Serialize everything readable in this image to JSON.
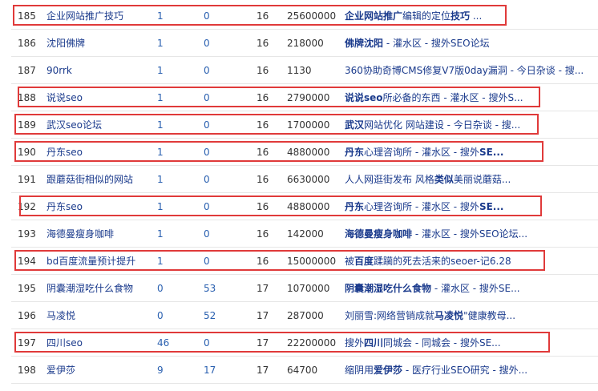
{
  "rows": [
    {
      "id": "185",
      "keyword": "企业网站推广技巧",
      "a": "1",
      "b": "0",
      "c": "16",
      "d": "25600000",
      "title_bold": "企业网站推广",
      "title_rest": "编辑的定位",
      "title_bold2": "技巧",
      "title_end": " ..."
    },
    {
      "id": "186",
      "keyword": "沈阳佛牌",
      "a": "1",
      "b": "0",
      "c": "16",
      "d": "218000",
      "title_bold": "佛牌沈阳",
      "title_rest": " - 灌水区 - 搜外SEO论坛",
      "title_bold2": "",
      "title_end": ""
    },
    {
      "id": "187",
      "keyword": "90rrk",
      "a": "1",
      "b": "0",
      "c": "16",
      "d": "1130",
      "title_bold": "",
      "title_rest": "360协助奇博CMS修复V7版0day漏洞 - 今日杂谈 - 搜...",
      "title_bold2": "",
      "title_end": ""
    },
    {
      "id": "188",
      "keyword": "说说seo",
      "a": "1",
      "b": "0",
      "c": "16",
      "d": "2790000",
      "title_bold": "说说seo",
      "title_rest": "所必备的东西 - 灌水区 - 搜外S...",
      "title_bold2": "",
      "title_end": ""
    },
    {
      "id": "189",
      "keyword": "武汉seo论坛",
      "a": "1",
      "b": "0",
      "c": "16",
      "d": "1700000",
      "title_bold": "武汉",
      "title_rest": "网站优化 网站建设 - 今日杂谈 - 搜...",
      "title_bold2": "",
      "title_end": ""
    },
    {
      "id": "190",
      "keyword": "丹东seo",
      "a": "1",
      "b": "0",
      "c": "16",
      "d": "4880000",
      "title_bold": "丹东",
      "title_rest": "心理咨询所 - 灌水区 - 搜外",
      "title_bold2": "SE...",
      "title_end": ""
    },
    {
      "id": "191",
      "keyword": "跟蘑菇街相似的网站",
      "a": "1",
      "b": "0",
      "c": "16",
      "d": "6630000",
      "title_bold": "",
      "title_rest": "人人网逛街发布 风格",
      "title_bold2": "类似",
      "title_end": "美丽说蘑菇..."
    },
    {
      "id": "192",
      "keyword": "丹东seo",
      "a": "1",
      "b": "0",
      "c": "16",
      "d": "4880000",
      "title_bold": "丹东",
      "title_rest": "心理咨询所 - 灌水区 - 搜外",
      "title_bold2": "SE...",
      "title_end": ""
    },
    {
      "id": "193",
      "keyword": "海德曼瘦身咖啡",
      "a": "1",
      "b": "0",
      "c": "16",
      "d": "142000",
      "title_bold": "海德曼瘦身咖啡",
      "title_rest": " - 灌水区 - 搜外SEO论坛...",
      "title_bold2": "",
      "title_end": ""
    },
    {
      "id": "194",
      "keyword": "bd百度流量预计提升",
      "a": "1",
      "b": "0",
      "c": "16",
      "d": "15000000",
      "title_bold": "",
      "title_rest": "被",
      "title_bold2": "百度",
      "title_end": "蹂躏的死去活来的seoer-记6.28"
    },
    {
      "id": "195",
      "keyword": "阴囊潮湿吃什么食物",
      "a": "0",
      "b": "53",
      "c": "17",
      "d": "1070000",
      "title_bold": "阴囊潮湿吃什么食物",
      "title_rest": " - 灌水区 - 搜外SE...",
      "title_bold2": "",
      "title_end": ""
    },
    {
      "id": "196",
      "keyword": "马凌悦",
      "a": "0",
      "b": "52",
      "c": "17",
      "d": "287000",
      "title_bold": "",
      "title_rest": "刘丽雪:网络营销成就",
      "title_bold2": "马凌悦",
      "title_end": "\"健康教母..."
    },
    {
      "id": "197",
      "keyword": "四川seo",
      "a": "46",
      "b": "0",
      "c": "17",
      "d": "22200000",
      "title_bold": "",
      "title_rest": "搜外",
      "title_bold2": "四川",
      "title_end": "同城会 - 同城会 - 搜外SE..."
    },
    {
      "id": "198",
      "keyword": "爱伊莎",
      "a": "9",
      "b": "17",
      "c": "17",
      "d": "64700",
      "title_bold": "",
      "title_rest": "缩阴用",
      "title_bold2": "爱伊莎",
      "title_end": " - 医疗行业SEO研究 - 搜外..."
    }
  ],
  "highlight_color": "#e03a3a"
}
